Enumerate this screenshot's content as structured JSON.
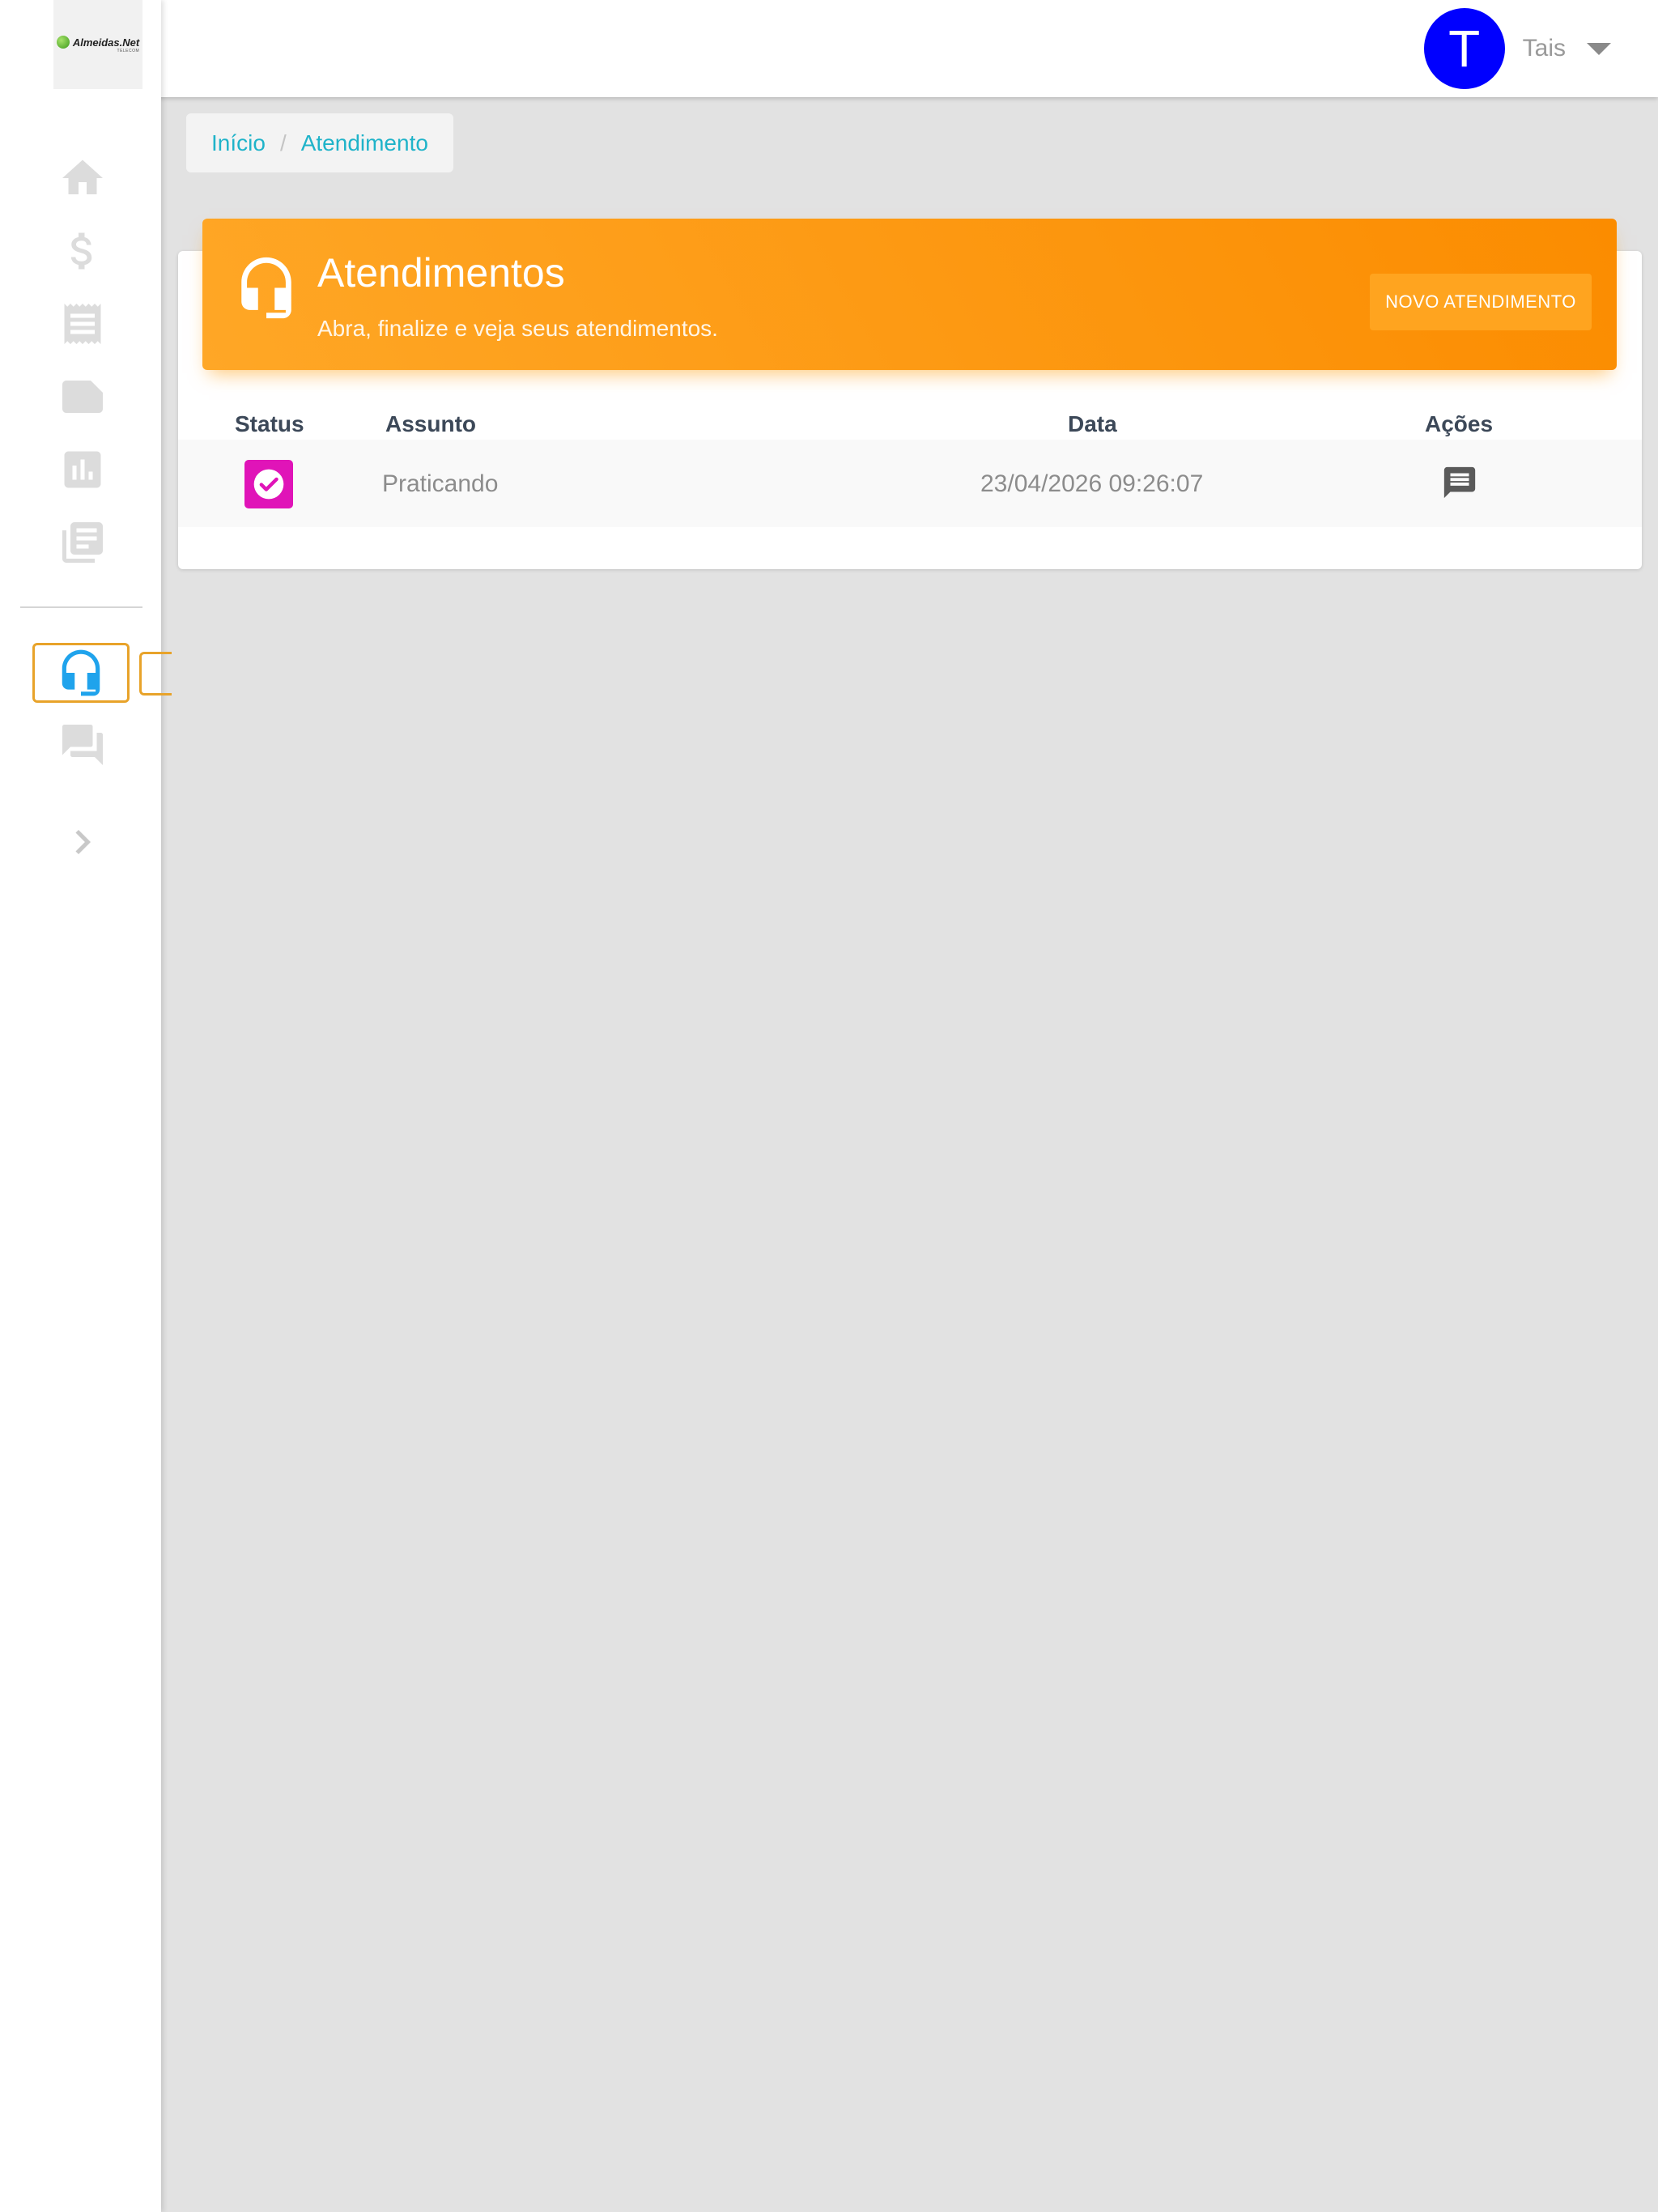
{
  "brand": {
    "logo_text": "Almeidas.Net",
    "logo_subtext": "TELECOM"
  },
  "user": {
    "initial": "T",
    "name": "Tais",
    "avatar_color": "#0000ff"
  },
  "sidebar": {
    "items": [
      {
        "icon": "home-icon"
      },
      {
        "icon": "dollar-icon"
      },
      {
        "icon": "receipt-icon"
      },
      {
        "icon": "note-icon"
      },
      {
        "icon": "chart-icon"
      },
      {
        "icon": "library-icon"
      },
      {
        "icon": "headset-icon",
        "active": true
      },
      {
        "icon": "forum-icon"
      },
      {
        "icon": "chevron-right-icon"
      }
    ]
  },
  "breadcrumb": {
    "home": "Início",
    "separator": "/",
    "current": "Atendimento"
  },
  "card": {
    "title": "Atendimentos",
    "subtitle": "Abra, finalize e veja seus atendimentos.",
    "new_button": "NOVO ATENDIMENTO",
    "header_color": "#fb8c00"
  },
  "table": {
    "headers": {
      "status": "Status",
      "subject": "Assunto",
      "date": "Data",
      "actions": "Ações"
    },
    "rows": [
      {
        "status": "check-icon",
        "status_color": "#e014b8",
        "subject": "Praticando",
        "date": "23/04/2026 09:26:07",
        "action": "comment-icon"
      }
    ]
  }
}
